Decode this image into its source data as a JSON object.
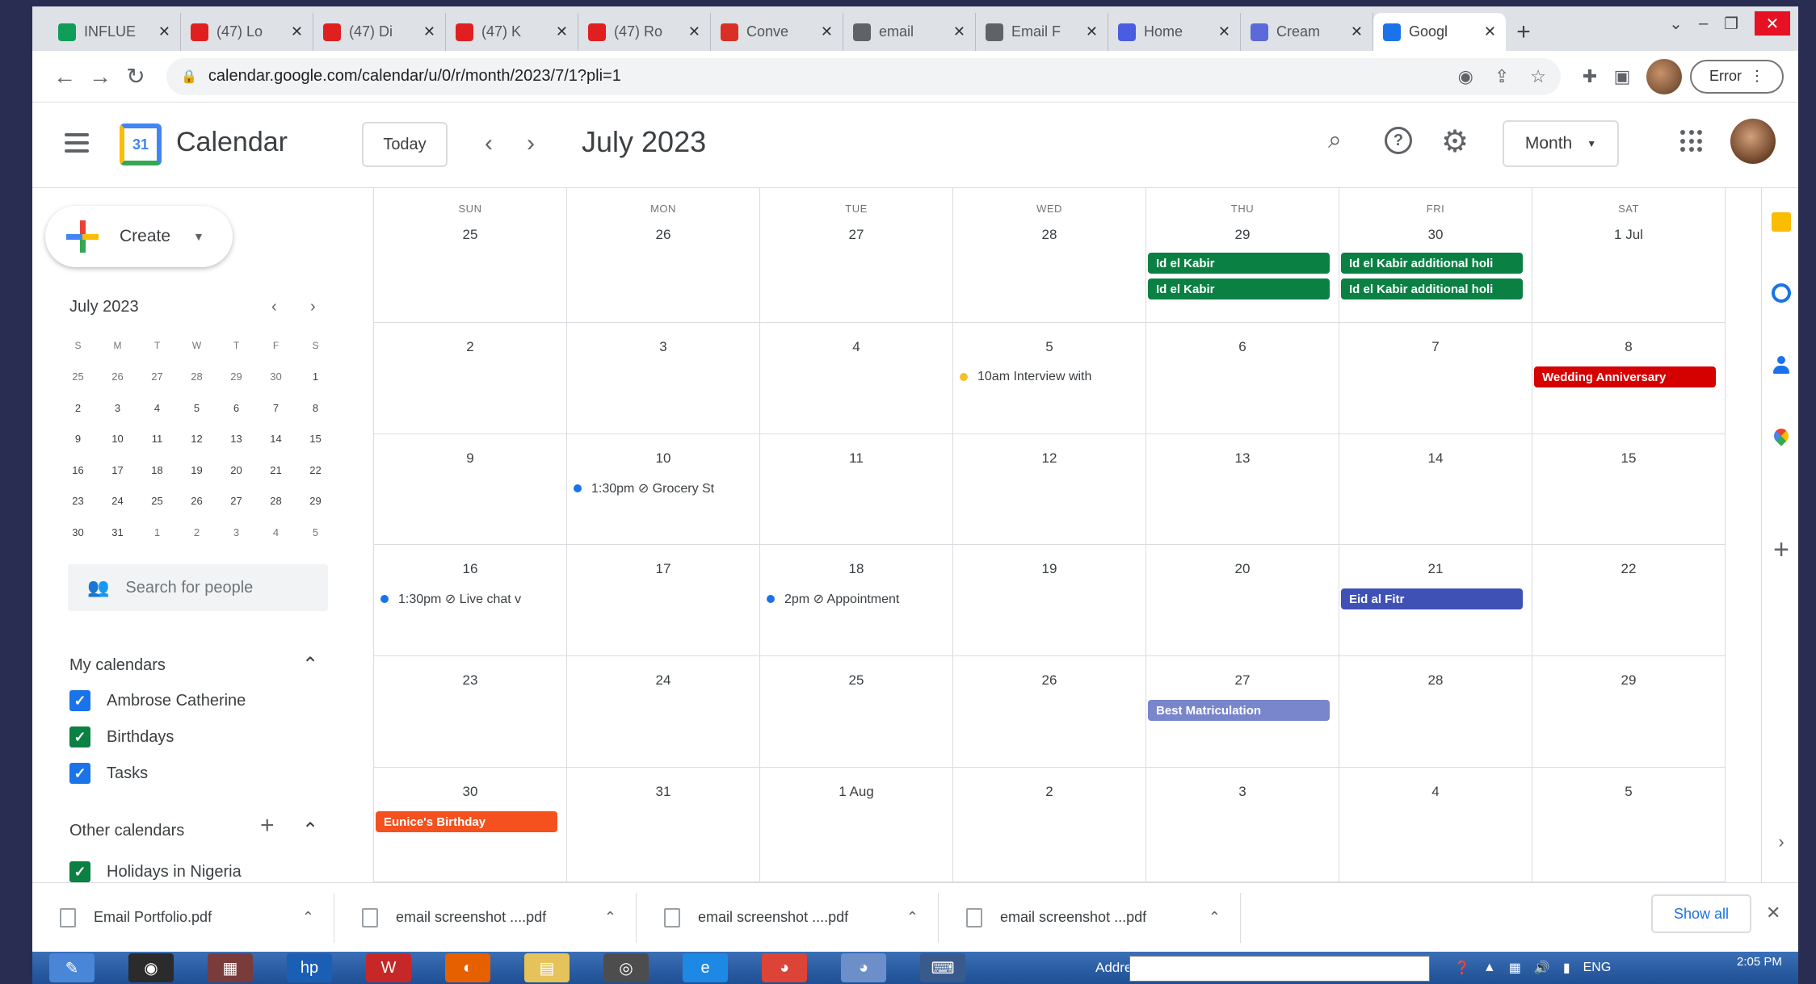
{
  "browser": {
    "tabs": [
      {
        "label": "INFLUE",
        "color": "#0f9d58",
        "icon": "spreadsheet-icon"
      },
      {
        "label": "(47) Lo",
        "color": "#e02020",
        "icon": "youtube-icon"
      },
      {
        "label": "(47) Di",
        "color": "#e02020",
        "icon": "youtube-icon"
      },
      {
        "label": "(47) K",
        "color": "#e02020",
        "icon": "youtube-icon"
      },
      {
        "label": "(47) Ro",
        "color": "#e02020",
        "icon": "youtube-icon"
      },
      {
        "label": "Conve",
        "color": "#d93025",
        "icon": "heart-icon"
      },
      {
        "label": "email",
        "color": "#5f6368",
        "icon": "globe-icon"
      },
      {
        "label": "Email F",
        "color": "#5f6368",
        "icon": "globe-icon"
      },
      {
        "label": "Home",
        "color": "#4a5de0",
        "icon": "canva-icon"
      },
      {
        "label": "Cream",
        "color": "#5b6ad8",
        "icon": "chat-icon"
      },
      {
        "label": "Googl",
        "color": "#1a73e8",
        "icon": "calendar-favicon-icon"
      }
    ],
    "url": "calendar.google.com/calendar/u/0/r/month/2023/7/1?pli=1",
    "error_label": "Error"
  },
  "header": {
    "app_title": "Calendar",
    "logo_day": "31",
    "today_label": "Today",
    "month_title": "July 2023",
    "view_label": "Month"
  },
  "sidebar": {
    "create_label": "Create",
    "mini_title": "July 2023",
    "weekdays": [
      "S",
      "M",
      "T",
      "W",
      "T",
      "F",
      "S"
    ],
    "mini_days": [
      [
        "25",
        "26",
        "27",
        "28",
        "29",
        "30",
        "1"
      ],
      [
        "2",
        "3",
        "4",
        "5",
        "6",
        "7",
        "8"
      ],
      [
        "9",
        "10",
        "11",
        "12",
        "13",
        "14",
        "15"
      ],
      [
        "16",
        "17",
        "18",
        "19",
        "20",
        "21",
        "22"
      ],
      [
        "23",
        "24",
        "25",
        "26",
        "27",
        "28",
        "29"
      ],
      [
        "30",
        "31",
        "1",
        "2",
        "3",
        "4",
        "5"
      ]
    ],
    "search_people_placeholder": "Search for people",
    "my_calendars_title": "My calendars",
    "my_calendars": [
      {
        "label": "Ambrose Catherine",
        "color": "#1a73e8"
      },
      {
        "label": "Birthdays",
        "color": "#0b8043"
      },
      {
        "label": "Tasks",
        "color": "#1a73e8"
      }
    ],
    "other_calendars_title": "Other calendars",
    "other_calendars": [
      {
        "label": "Holidays in Nigeria",
        "color": "#0b8043"
      }
    ]
  },
  "month": {
    "dow": [
      "SUN",
      "MON",
      "TUE",
      "WED",
      "THU",
      "FRI",
      "SAT"
    ],
    "weeks": [
      [
        {
          "num": "25",
          "events": []
        },
        {
          "num": "26",
          "events": []
        },
        {
          "num": "27",
          "events": []
        },
        {
          "num": "28",
          "events": []
        },
        {
          "num": "29",
          "events": [
            {
              "type": "chip",
              "label": "Id el Kabir",
              "color": "#0b8043"
            },
            {
              "type": "chip",
              "label": "Id el Kabir",
              "color": "#0b8043"
            }
          ]
        },
        {
          "num": "30",
          "events": [
            {
              "type": "chip",
              "label": "Id el Kabir additional holi",
              "color": "#0b8043"
            },
            {
              "type": "chip",
              "label": "Id el Kabir additional holi",
              "color": "#0b8043"
            }
          ]
        },
        {
          "num": "1 Jul",
          "events": []
        }
      ],
      [
        {
          "num": "2",
          "events": []
        },
        {
          "num": "3",
          "events": []
        },
        {
          "num": "4",
          "events": []
        },
        {
          "num": "5",
          "events": [
            {
              "type": "dot",
              "label": "10am Interview with",
              "color": "#f6bf26"
            }
          ]
        },
        {
          "num": "6",
          "events": []
        },
        {
          "num": "7",
          "events": []
        },
        {
          "num": "8",
          "events": [
            {
              "type": "chip",
              "label": "Wedding Anniversary",
              "color": "#d50000"
            }
          ]
        }
      ],
      [
        {
          "num": "9",
          "events": []
        },
        {
          "num": "10",
          "events": [
            {
              "type": "dot",
              "label": "1:30pm ⊘ Grocery St",
              "color": "#1a73e8"
            }
          ]
        },
        {
          "num": "11",
          "events": []
        },
        {
          "num": "12",
          "events": []
        },
        {
          "num": "13",
          "events": []
        },
        {
          "num": "14",
          "events": []
        },
        {
          "num": "15",
          "events": []
        }
      ],
      [
        {
          "num": "16",
          "events": [
            {
              "type": "dot",
              "label": "1:30pm ⊘ Live chat v",
              "color": "#1a73e8"
            }
          ]
        },
        {
          "num": "17",
          "events": []
        },
        {
          "num": "18",
          "events": [
            {
              "type": "dot",
              "label": "2pm ⊘ Appointment",
              "color": "#1a73e8"
            }
          ]
        },
        {
          "num": "19",
          "events": []
        },
        {
          "num": "20",
          "events": []
        },
        {
          "num": "21",
          "events": [
            {
              "type": "chip",
              "label": "Eid al Fitr",
              "color": "#3f51b5"
            }
          ]
        },
        {
          "num": "22",
          "events": []
        }
      ],
      [
        {
          "num": "23",
          "events": []
        },
        {
          "num": "24",
          "events": []
        },
        {
          "num": "25",
          "events": []
        },
        {
          "num": "26",
          "events": []
        },
        {
          "num": "27",
          "events": [
            {
              "type": "chip",
              "label": "Best Matriculation",
              "color": "#7986cb"
            }
          ]
        },
        {
          "num": "28",
          "events": []
        },
        {
          "num": "29",
          "events": []
        }
      ],
      [
        {
          "num": "30",
          "events": [
            {
              "type": "chip",
              "label": "Eunice's Birthday",
              "color": "#f4511e"
            }
          ]
        },
        {
          "num": "31",
          "events": []
        },
        {
          "num": "1 Aug",
          "events": []
        },
        {
          "num": "2",
          "events": []
        },
        {
          "num": "3",
          "events": []
        },
        {
          "num": "4",
          "events": []
        },
        {
          "num": "5",
          "events": []
        }
      ]
    ]
  },
  "downloads": {
    "items": [
      "Email Portfolio.pdf",
      "email screenshot ....pdf",
      "email screenshot ....pdf",
      "email screenshot ...pdf"
    ],
    "show_all_label": "Show all"
  },
  "taskbar": {
    "address_label": "Address",
    "language": "ENG",
    "time": "2:05 PM"
  },
  "colors": {
    "accent": "#1a73e8",
    "today_highlight": "#d2e3fc"
  }
}
